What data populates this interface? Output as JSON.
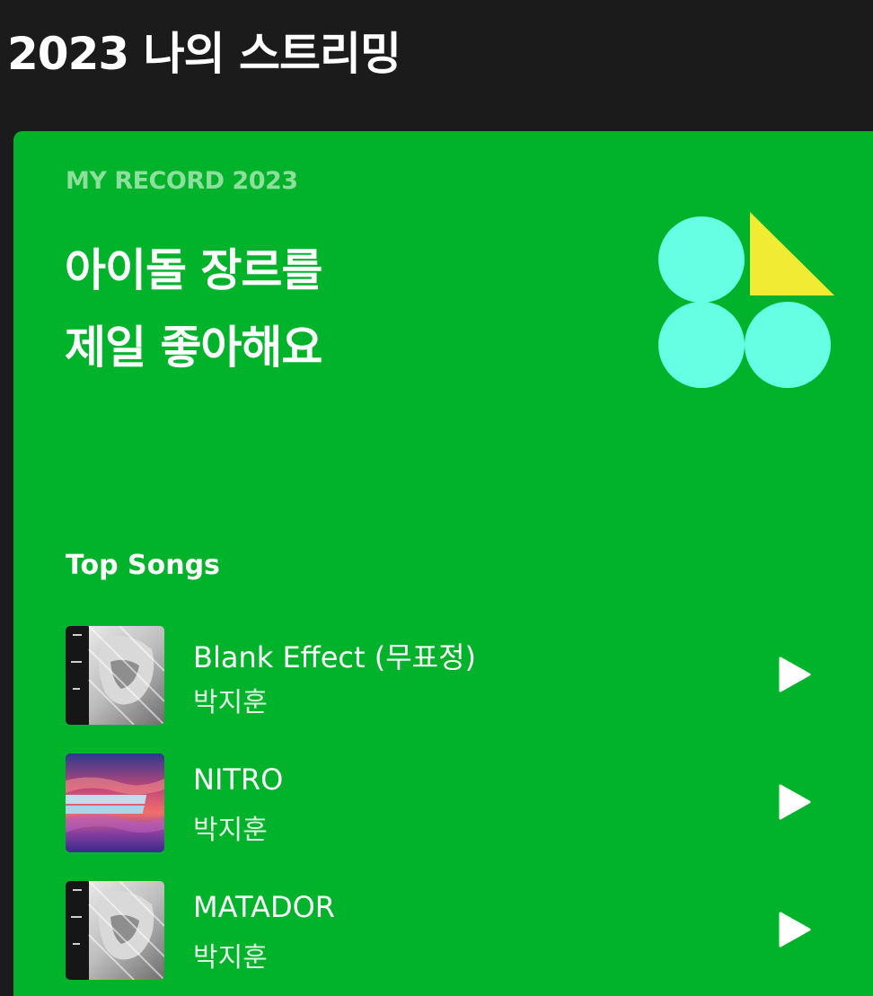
{
  "header": {
    "title": "2023 나의 스트리밍"
  },
  "card": {
    "record_label": "MY RECORD 2023",
    "headline_line1": "아이돌 장르를",
    "headline_line2": "제일 좋아해요",
    "graphic_icon": "genre-shapes-icon",
    "colors": {
      "background": "#00b32b",
      "circles": "#66ffe4",
      "triangle": "#f2eb33"
    }
  },
  "top_songs": {
    "heading": "Top Songs",
    "songs": [
      {
        "title": "Blank Effect (무표정)",
        "artist": "박지훈",
        "art": "grayscale-portrait",
        "play_icon": "play-icon"
      },
      {
        "title": "NITRO",
        "artist": "박지훈",
        "art": "sunset-the-answer",
        "play_icon": "play-icon"
      },
      {
        "title": "MATADOR",
        "artist": "박지훈",
        "art": "grayscale-portrait",
        "play_icon": "play-icon"
      }
    ]
  }
}
